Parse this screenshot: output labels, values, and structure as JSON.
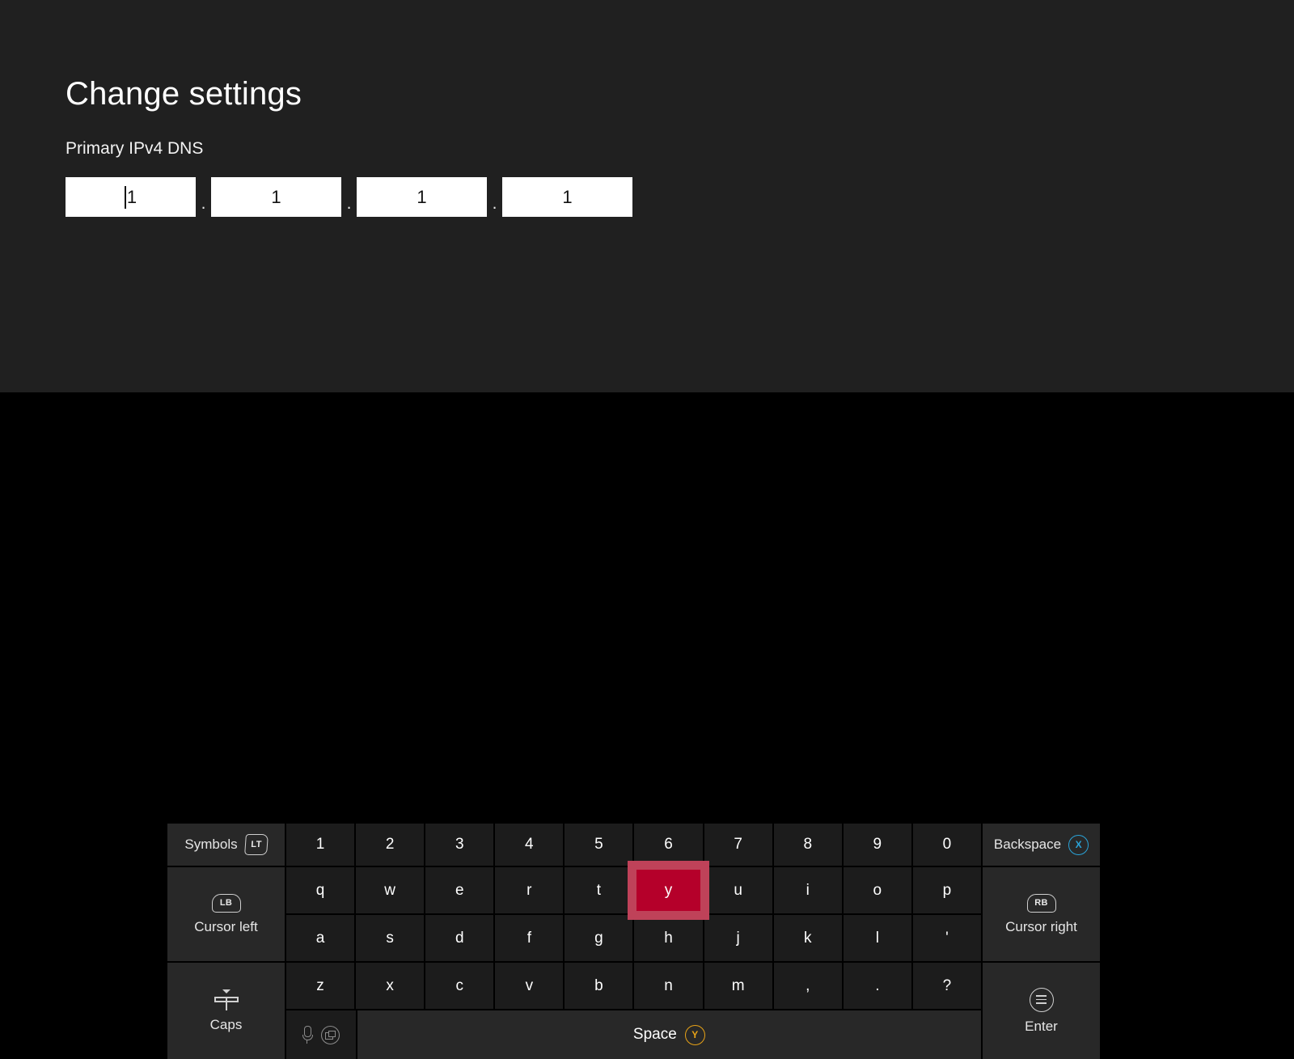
{
  "screen": {
    "title": "Change settings",
    "panel_bg": "#202020",
    "keyboard_bg": "#000000"
  },
  "form": {
    "field_label": "Primary IPv4 DNS",
    "separator": ".",
    "octets": [
      {
        "value": "1",
        "focused": true
      },
      {
        "value": "1",
        "focused": false
      },
      {
        "value": "1",
        "focused": false
      },
      {
        "value": "1",
        "focused": false
      }
    ]
  },
  "keyboard": {
    "highlight_color": "#b5002a",
    "highlight_border_color": "#bf4259",
    "highlighted_key": "y",
    "left_column": [
      {
        "label": "Symbols",
        "glyph": "trigger-lt-icon",
        "glyph_text": "LT",
        "name": "symbols"
      },
      {
        "label": "Cursor left",
        "glyph": "bumper-lb-icon",
        "glyph_text": "LB",
        "name": "cursor-left"
      },
      {
        "label": "Caps",
        "glyph": "caps-lock-icon",
        "glyph_text": "",
        "name": "caps"
      }
    ],
    "right_column": [
      {
        "label": "Backspace",
        "glyph": "button-x-icon",
        "glyph_text": "X",
        "name": "backspace"
      },
      {
        "label": "Cursor right",
        "glyph": "bumper-rb-icon",
        "glyph_text": "RB",
        "name": "cursor-right"
      },
      {
        "label": "Enter",
        "glyph": "menu-button-icon",
        "glyph_text": "",
        "name": "enter"
      }
    ],
    "rows": [
      [
        "1",
        "2",
        "3",
        "4",
        "5",
        "6",
        "7",
        "8",
        "9",
        "0"
      ],
      [
        "q",
        "w",
        "e",
        "r",
        "t",
        "y",
        "u",
        "i",
        "o",
        "p"
      ],
      [
        "a",
        "s",
        "d",
        "f",
        "g",
        "h",
        "j",
        "k",
        "l",
        "'"
      ],
      [
        "z",
        "x",
        "c",
        "v",
        "b",
        "n",
        "m",
        ",",
        ".",
        "?"
      ]
    ],
    "space": {
      "label": "Space",
      "glyph_text": "Y",
      "utilities": [
        "microphone-icon",
        "clipboard-icon"
      ]
    }
  }
}
